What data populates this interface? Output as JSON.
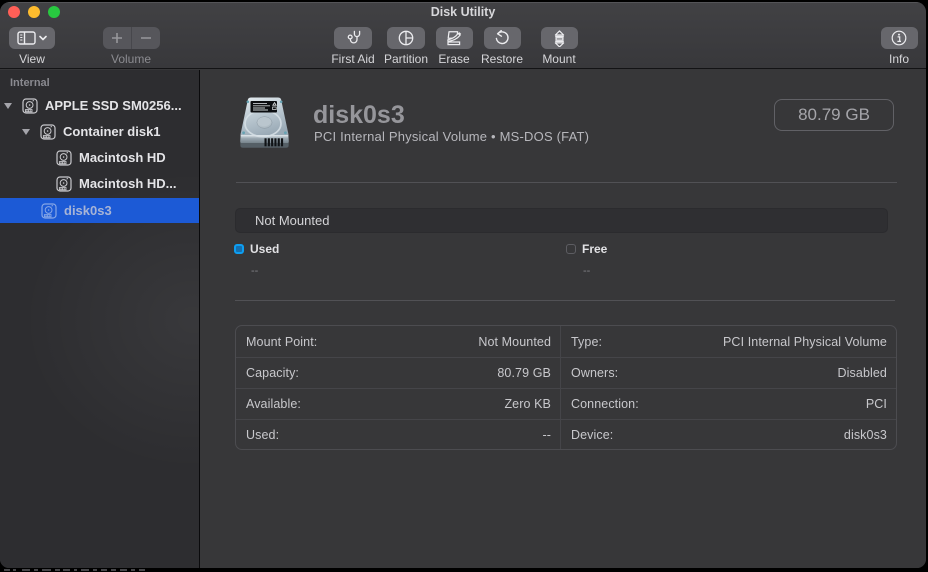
{
  "window": {
    "title": "Disk Utility"
  },
  "toolbar": {
    "view": {
      "label": "View",
      "icon": "sidebar-icon + chevron-down-icon"
    },
    "volume": {
      "label": "Volume",
      "icons": [
        "plus-icon",
        "minus-icon"
      ],
      "disabled": true
    },
    "first_aid": {
      "label": "First Aid",
      "icon": "stethoscope-icon"
    },
    "partition": {
      "label": "Partition",
      "icon": "pie-chart-icon"
    },
    "erase": {
      "label": "Erase",
      "icon": "erase-pencil-icon"
    },
    "restore": {
      "label": "Restore",
      "icon": "undo-arrow-icon"
    },
    "mount": {
      "label": "Mount",
      "icon": "mount-eject-icon"
    },
    "info": {
      "label": "Info",
      "icon": "info-circle-icon"
    }
  },
  "sidebar": {
    "section_label": "Internal",
    "items": [
      {
        "label": "APPLE SSD SM0256...",
        "level": 0,
        "expanded": true,
        "selected": false
      },
      {
        "label": "Container disk1",
        "level": 1,
        "expanded": true,
        "selected": false
      },
      {
        "label": "Macintosh HD",
        "level": 2,
        "expanded": false,
        "selected": false
      },
      {
        "label": "Macintosh HD...",
        "level": 2,
        "expanded": false,
        "selected": false
      },
      {
        "label": "disk0s3",
        "level": 1,
        "expanded": false,
        "selected": true,
        "dimmed": true
      }
    ]
  },
  "main": {
    "header": {
      "title": "disk0s3",
      "subtitle": "PCI Internal Physical Volume • MS-DOS (FAT)",
      "size_badge": "80.79 GB"
    },
    "usage_bar": {
      "label": "Not Mounted"
    },
    "legend": [
      {
        "label": "Used",
        "value": "--",
        "swatch": "blue-filled"
      },
      {
        "label": "Free",
        "value": "--",
        "swatch": "empty"
      }
    ],
    "details": {
      "left": [
        {
          "label": "Mount Point:",
          "value": "Not Mounted"
        },
        {
          "label": "Capacity:",
          "value": "80.79 GB"
        },
        {
          "label": "Available:",
          "value": "Zero KB"
        },
        {
          "label": "Used:",
          "value": "--"
        }
      ],
      "right": [
        {
          "label": "Type:",
          "value": "PCI Internal Physical Volume"
        },
        {
          "label": "Owners:",
          "value": "Disabled"
        },
        {
          "label": "Connection:",
          "value": "PCI"
        },
        {
          "label": "Device:",
          "value": "disk0s3"
        }
      ]
    }
  },
  "colors": {
    "selection_blue": "#1c5ad6",
    "traffic_red": "#ff5f57",
    "traffic_yellow": "#febc2e",
    "traffic_green": "#28c840",
    "used_swatch_border": "#0d9ef2",
    "used_swatch_fill": "#156fae"
  }
}
